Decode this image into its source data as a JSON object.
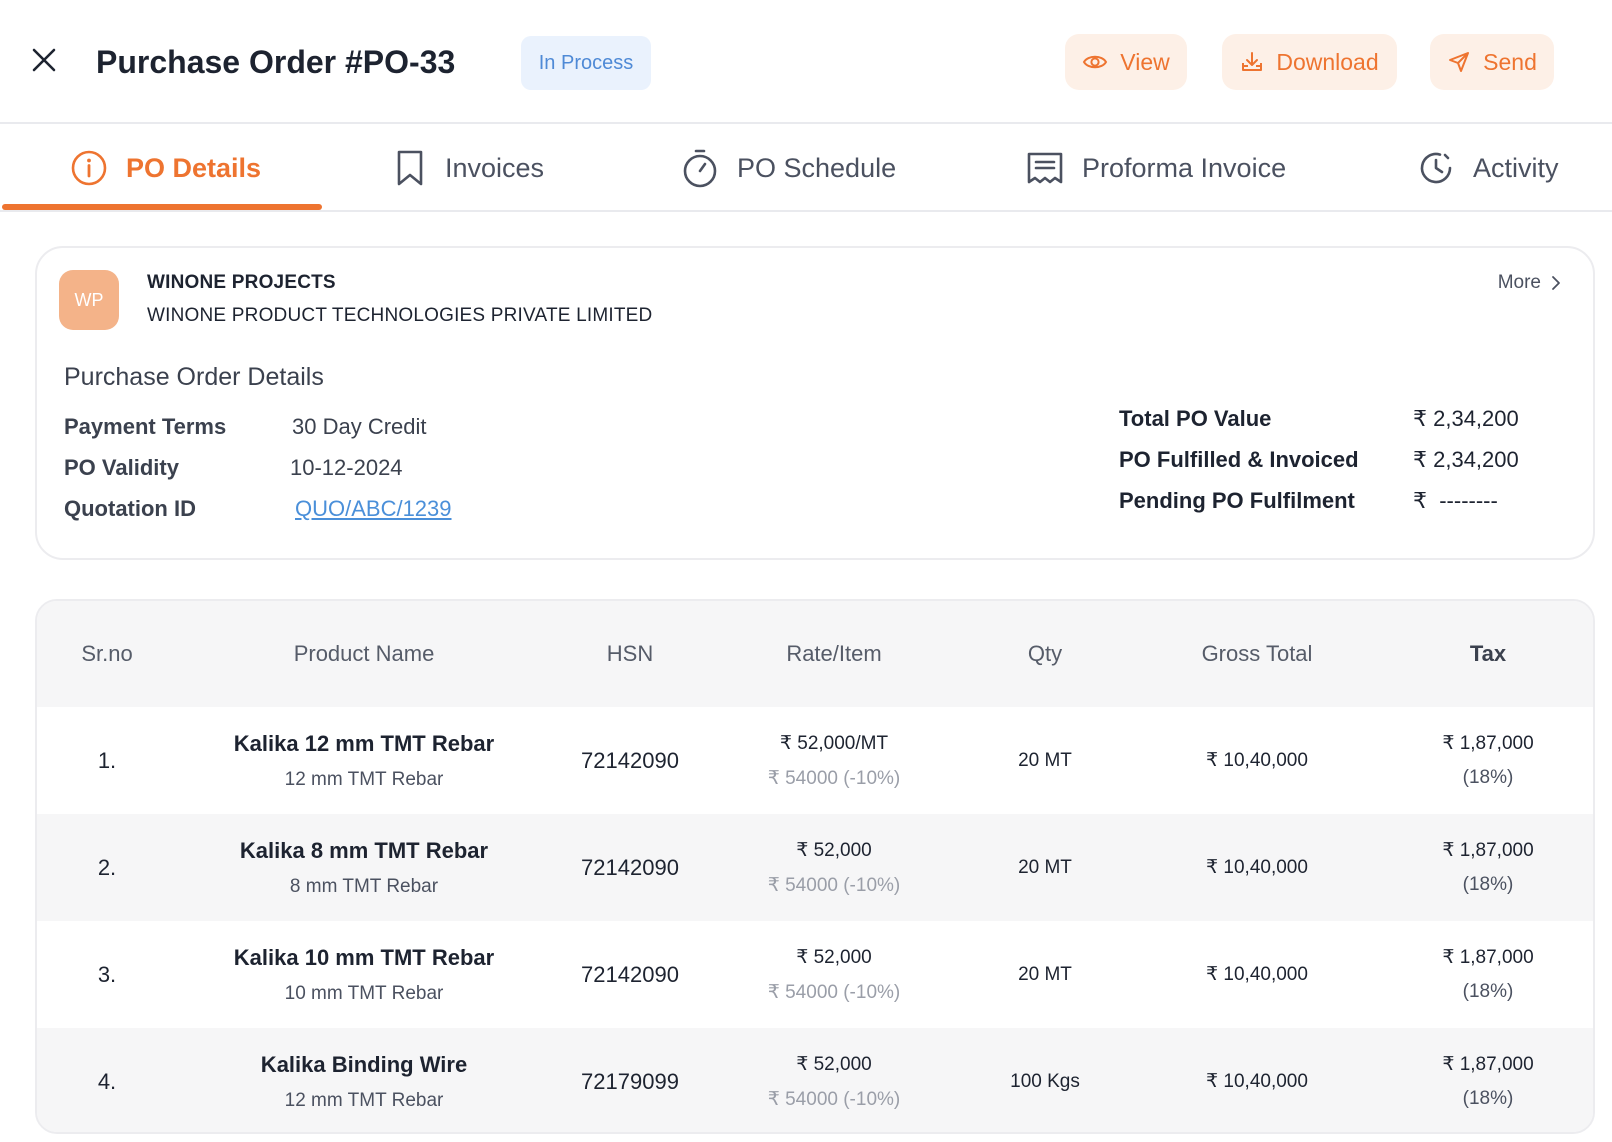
{
  "header": {
    "title": "Purchase Order #PO-33",
    "status": "In Process",
    "actions": {
      "view": "View",
      "download": "Download",
      "send": "Send"
    }
  },
  "tabs": [
    {
      "label": "PO Details",
      "icon": "info-icon",
      "active": true
    },
    {
      "label": "Invoices",
      "icon": "bookmark-icon"
    },
    {
      "label": "PO Schedule",
      "icon": "stopwatch-icon"
    },
    {
      "label": "Proforma Invoice",
      "icon": "receipt-icon"
    },
    {
      "label": "Activity",
      "icon": "history-icon"
    }
  ],
  "vendor": {
    "initials": "WP",
    "short_name": "WINONE PROJECTS",
    "full_name": "WINONE PRODUCT TECHNOLOGIES PRIVATE LIMITED",
    "more_label": "More"
  },
  "details": {
    "section_title": "Purchase Order Details",
    "payment_terms": {
      "label": "Payment Terms",
      "value": "30 Day Credit"
    },
    "po_validity": {
      "label": "PO Validity",
      "value": "10-12-2024"
    },
    "quotation_id": {
      "label": "Quotation ID",
      "value": "QUO/ABC/1239"
    }
  },
  "summary": {
    "total": {
      "label": "Total PO Value",
      "value": "₹ 2,34,200"
    },
    "fulfilled": {
      "label": "PO Fulfilled & Invoiced",
      "value": "₹ 2,34,200"
    },
    "pending": {
      "label": "Pending PO Fulfilment",
      "value": "₹  --------"
    }
  },
  "table": {
    "headers": [
      "Sr.no",
      "Product Name",
      "HSN",
      "Rate/Item",
      "Qty",
      "Gross Total",
      "Tax"
    ],
    "rows": [
      {
        "sr": "1.",
        "name": "Kalika 12 mm TMT Rebar",
        "sub": "12 mm TMT Rebar",
        "hsn": "72142090",
        "rate": "₹ 52,000/MT",
        "rate_orig": "₹ 54000 (-10%)",
        "qty": "20 MT",
        "gross": "₹ 10,40,000",
        "tax": "₹ 1,87,000",
        "tax_pct": "(18%)"
      },
      {
        "sr": "2.",
        "name": "Kalika 8 mm TMT Rebar",
        "sub": "8 mm TMT Rebar",
        "hsn": "72142090",
        "rate": "₹ 52,000",
        "rate_orig": "₹ 54000 (-10%)",
        "qty": "20 MT",
        "gross": "₹ 10,40,000",
        "tax": "₹ 1,87,000",
        "tax_pct": "(18%)"
      },
      {
        "sr": "3.",
        "name": "Kalika 10 mm TMT Rebar",
        "sub": "10 mm TMT Rebar",
        "hsn": "72142090",
        "rate": "₹ 52,000",
        "rate_orig": "₹ 54000 (-10%)",
        "qty": "20 MT",
        "gross": "₹ 10,40,000",
        "tax": "₹ 1,87,000",
        "tax_pct": "(18%)"
      },
      {
        "sr": "4.",
        "name": "Kalika Binding Wire",
        "sub": "12 mm TMT Rebar",
        "hsn": "72179099",
        "rate": "₹ 52,000",
        "rate_orig": "₹ 54000 (-10%)",
        "qty": "100 Kgs",
        "gross": "₹ 10,40,000",
        "tax": "₹ 1,87,000",
        "tax_pct": "(18%)"
      }
    ]
  },
  "colors": {
    "accent": "#ee7430",
    "accent_bg": "#fdf0e7",
    "badge_bg": "#eaf2fd",
    "badge_text": "#4f8ad6",
    "link": "#4a8fd9"
  }
}
